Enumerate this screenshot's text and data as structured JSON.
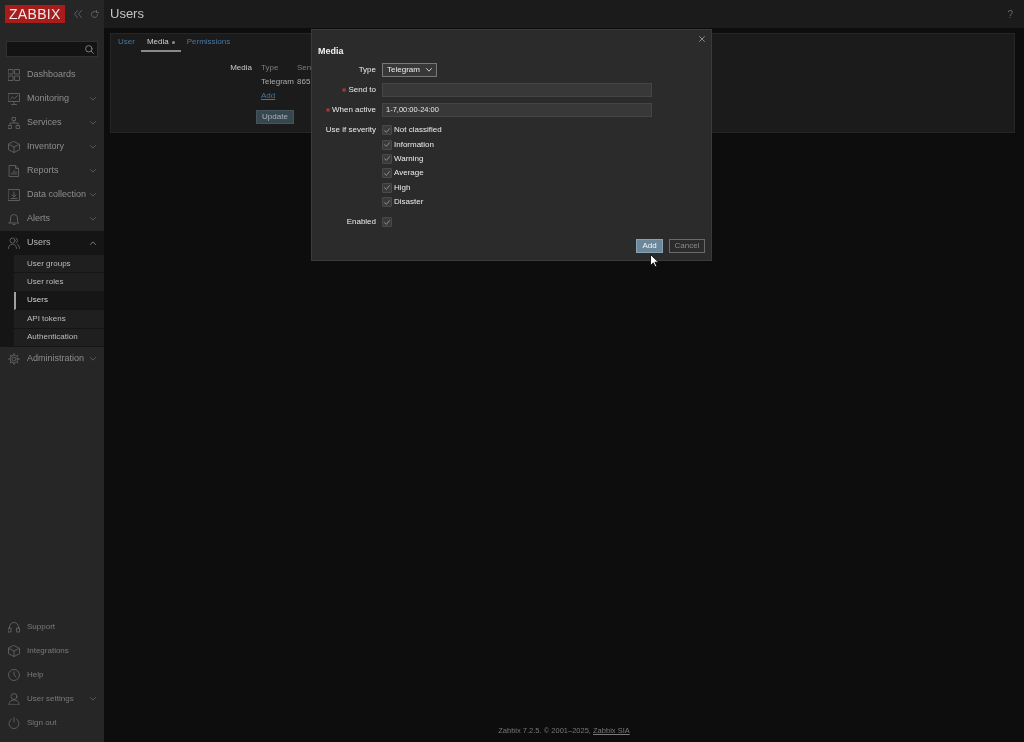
{
  "header": {
    "title": "Users",
    "help": "?"
  },
  "sidebar": {
    "logo": "ZABBIX",
    "menu": [
      {
        "label": "Dashboards",
        "kind": "link"
      },
      {
        "label": "Monitoring",
        "kind": "group",
        "expanded": false
      },
      {
        "label": "Services",
        "kind": "group",
        "expanded": false
      },
      {
        "label": "Inventory",
        "kind": "group",
        "expanded": false
      },
      {
        "label": "Reports",
        "kind": "group",
        "expanded": false
      },
      {
        "label": "Data collection",
        "kind": "group",
        "expanded": false
      },
      {
        "label": "Alerts",
        "kind": "group",
        "expanded": false
      },
      {
        "label": "Users",
        "kind": "group",
        "expanded": true,
        "children": [
          {
            "label": "User groups",
            "selected": false
          },
          {
            "label": "User roles",
            "selected": false
          },
          {
            "label": "Users",
            "selected": true
          },
          {
            "label": "API tokens",
            "selected": false
          },
          {
            "label": "Authentication",
            "selected": false
          }
        ]
      },
      {
        "label": "Administration",
        "kind": "group",
        "expanded": false
      }
    ],
    "bottom_menu": [
      {
        "label": "Support",
        "kind": "link"
      },
      {
        "label": "Integrations",
        "kind": "link"
      },
      {
        "label": "Help",
        "kind": "link"
      },
      {
        "label": "User settings",
        "kind": "group",
        "expanded": false
      },
      {
        "label": "Sign out",
        "kind": "link"
      }
    ]
  },
  "tabs": [
    {
      "label": "User",
      "selected": false,
      "indicator": false
    },
    {
      "label": "Media",
      "selected": true,
      "indicator": true
    },
    {
      "label": "Permissions",
      "selected": false,
      "indicator": false
    }
  ],
  "media_form": {
    "label": "Media",
    "table": {
      "columns": [
        "Type",
        "Sen"
      ],
      "rows": [
        [
          "Telegram",
          "865"
        ]
      ]
    },
    "add_link": "Add",
    "button": "Update"
  },
  "modal": {
    "title": "Media",
    "fields": [
      {
        "label": "Type",
        "required": false,
        "kind": "select",
        "value": "Telegram"
      },
      {
        "label": "Send to",
        "required": true,
        "kind": "text"
      },
      {
        "label": "When active",
        "required": true,
        "kind": "text",
        "value": "1-7,00:00-24:00"
      }
    ],
    "severity": {
      "label": "Use if severity",
      "options": [
        {
          "label": "Not classified",
          "checked": true
        },
        {
          "label": "Information",
          "checked": true
        },
        {
          "label": "Warning",
          "checked": true
        },
        {
          "label": "Average",
          "checked": true
        },
        {
          "label": "High",
          "checked": true
        },
        {
          "label": "Disaster",
          "checked": true
        }
      ]
    },
    "enabled": {
      "label": "Enabled",
      "checked": true
    },
    "buttons": [
      {
        "label": "Add",
        "kind": "primary"
      },
      {
        "label": "Cancel",
        "kind": "secondary"
      }
    ]
  },
  "footer": {
    "text": "Zabbix 7.2.5. © 2001–2025,",
    "link": "Zabbix SIA"
  }
}
